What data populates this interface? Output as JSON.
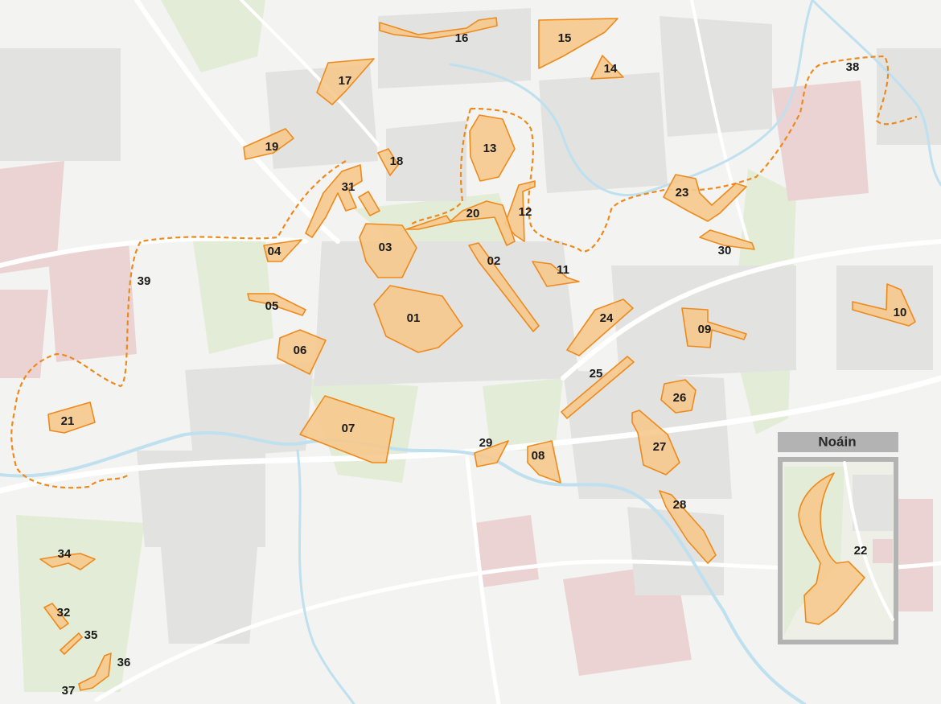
{
  "map": {
    "zones": [
      {
        "id": "01",
        "label": "01"
      },
      {
        "id": "02",
        "label": "02"
      },
      {
        "id": "03",
        "label": "03"
      },
      {
        "id": "04",
        "label": "04"
      },
      {
        "id": "05",
        "label": "05"
      },
      {
        "id": "06",
        "label": "06"
      },
      {
        "id": "07",
        "label": "07"
      },
      {
        "id": "08",
        "label": "08"
      },
      {
        "id": "09",
        "label": "09"
      },
      {
        "id": "10",
        "label": "10"
      },
      {
        "id": "11",
        "label": "11"
      },
      {
        "id": "12",
        "label": "12"
      },
      {
        "id": "13",
        "label": "13"
      },
      {
        "id": "14",
        "label": "14"
      },
      {
        "id": "15",
        "label": "15"
      },
      {
        "id": "16",
        "label": "16"
      },
      {
        "id": "17",
        "label": "17"
      },
      {
        "id": "18",
        "label": "18"
      },
      {
        "id": "19",
        "label": "19"
      },
      {
        "id": "20",
        "label": "20"
      },
      {
        "id": "21",
        "label": "21"
      },
      {
        "id": "22",
        "label": "22"
      },
      {
        "id": "23",
        "label": "23"
      },
      {
        "id": "24",
        "label": "24"
      },
      {
        "id": "25",
        "label": "25"
      },
      {
        "id": "26",
        "label": "26"
      },
      {
        "id": "27",
        "label": "27"
      },
      {
        "id": "28",
        "label": "28"
      },
      {
        "id": "29",
        "label": "29"
      },
      {
        "id": "30",
        "label": "30"
      },
      {
        "id": "31",
        "label": "31"
      },
      {
        "id": "32",
        "label": "32"
      },
      {
        "id": "34",
        "label": "34"
      },
      {
        "id": "35",
        "label": "35"
      },
      {
        "id": "36",
        "label": "36"
      },
      {
        "id": "37",
        "label": "37"
      },
      {
        "id": "38",
        "label": "38"
      },
      {
        "id": "39",
        "label": "39"
      }
    ],
    "inset": {
      "title": "Noáin"
    },
    "colors": {
      "zone_fill": "#f6c98d",
      "zone_stroke": "#ee8a1c",
      "boundary": "#ee8a1c",
      "river": "#bfe0ee",
      "background": "#f3f3f1",
      "inset_frame": "#b3b3b3"
    }
  }
}
